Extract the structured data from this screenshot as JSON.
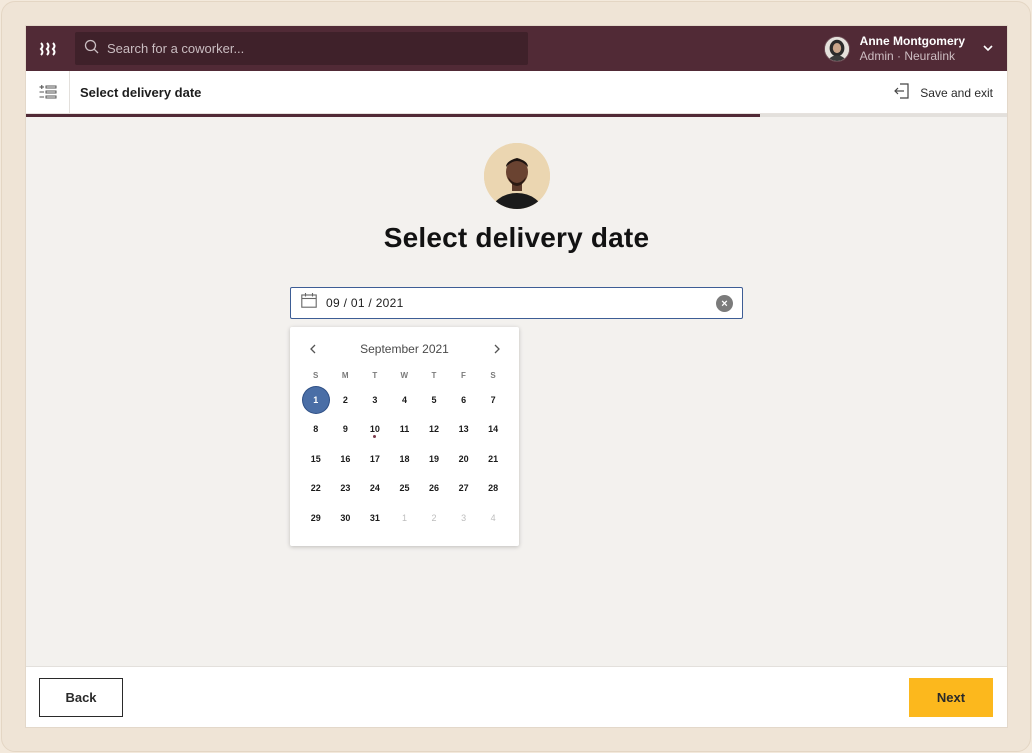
{
  "topbar": {
    "logo_icon": "company-logo",
    "search": {
      "placeholder": "Search for a coworker..."
    },
    "user": {
      "name": "Anne Montgomery",
      "role": "Admin · Neuralink"
    }
  },
  "subheader": {
    "title": "Select delivery date",
    "save_exit_label": "Save and exit"
  },
  "progress": {
    "fraction": 0.748
  },
  "main": {
    "title": "Select delivery date",
    "date_field": {
      "value": "09 / 01 / 2021"
    }
  },
  "calendar": {
    "month_label": "September 2021",
    "weekdays": [
      "S",
      "M",
      "T",
      "W",
      "T",
      "F",
      "S"
    ],
    "weeks": [
      [
        {
          "d": "1",
          "selected": true
        },
        {
          "d": "2"
        },
        {
          "d": "3"
        },
        {
          "d": "4"
        },
        {
          "d": "5"
        },
        {
          "d": "6"
        },
        {
          "d": "7"
        }
      ],
      [
        {
          "d": "8"
        },
        {
          "d": "9"
        },
        {
          "d": "10",
          "dot": true
        },
        {
          "d": "11"
        },
        {
          "d": "12"
        },
        {
          "d": "13"
        },
        {
          "d": "14"
        }
      ],
      [
        {
          "d": "15"
        },
        {
          "d": "16"
        },
        {
          "d": "17"
        },
        {
          "d": "18"
        },
        {
          "d": "19"
        },
        {
          "d": "20"
        },
        {
          "d": "21"
        }
      ],
      [
        {
          "d": "22"
        },
        {
          "d": "23"
        },
        {
          "d": "24"
        },
        {
          "d": "25"
        },
        {
          "d": "26"
        },
        {
          "d": "27"
        },
        {
          "d": "28"
        }
      ],
      [
        {
          "d": "29"
        },
        {
          "d": "30"
        },
        {
          "d": "31"
        },
        {
          "d": "1",
          "muted": true
        },
        {
          "d": "2",
          "muted": true
        },
        {
          "d": "3",
          "muted": true
        },
        {
          "d": "4",
          "muted": true
        }
      ]
    ]
  },
  "footer": {
    "back_label": "Back",
    "next_label": "Next"
  },
  "colors": {
    "topbar": "#512a36",
    "accent_selected": "#4a6ea6",
    "next_button": "#fcb81d"
  }
}
